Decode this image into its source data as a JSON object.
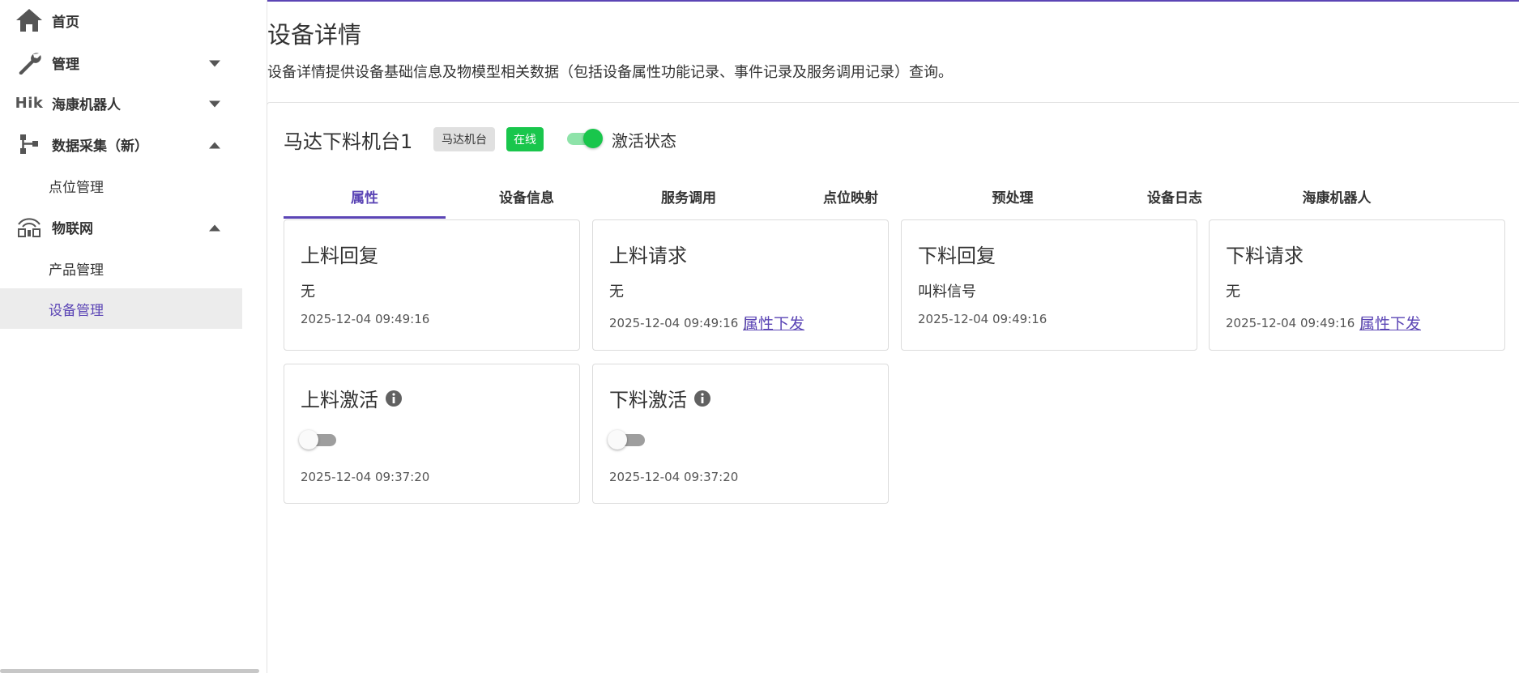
{
  "sidebar": {
    "items": [
      {
        "label": "首页",
        "icon": "home-icon"
      },
      {
        "label": "管理",
        "icon": "wrench-icon",
        "caret": "down"
      },
      {
        "label": "海康机器人",
        "icon": "hik-logo",
        "logo_text": "Hik",
        "caret": "down"
      },
      {
        "label": "数据采集（新）",
        "icon": "hierarchy-icon",
        "caret": "up"
      },
      {
        "label": "点位管理"
      },
      {
        "label": "物联网",
        "icon": "iot-icon",
        "caret": "up"
      },
      {
        "label": "产品管理"
      },
      {
        "label": "设备管理",
        "active": true
      }
    ]
  },
  "page": {
    "title": "设备详情",
    "description": "设备详情提供设备基础信息及物模型相关数据（包括设备属性功能记录、事件记录及服务调用记录）查询。"
  },
  "device": {
    "name": "马达下料机台1",
    "model_chip": "马达机台",
    "status_chip": "在线",
    "status_color": "#19c64c",
    "active_toggle_on": true,
    "active_label": "激活状态"
  },
  "tabs": [
    {
      "label": "属性",
      "active": true
    },
    {
      "label": "设备信息"
    },
    {
      "label": "服务调用"
    },
    {
      "label": "点位映射"
    },
    {
      "label": "预处理"
    },
    {
      "label": "设备日志"
    },
    {
      "label": "海康机器人"
    }
  ],
  "cards": [
    {
      "title": "上料回复",
      "value": "无",
      "time": "2025-12-04 09:49:16"
    },
    {
      "title": "上料请求",
      "value": "无",
      "time": "2025-12-04 09:49:16",
      "separator": "|",
      "link": "属性下发"
    },
    {
      "title": "下料回复",
      "value": "叫料信号",
      "time": "2025-12-04 09:49:16"
    },
    {
      "title": "下料请求",
      "value": "无",
      "time": "2025-12-04 09:49:16",
      "separator": "|",
      "link": "属性下发"
    },
    {
      "title": "上料激活",
      "toggle_on": false,
      "time": "2025-12-04 09:37:20"
    },
    {
      "title": "下料激活",
      "toggle_on": false,
      "time": "2025-12-04 09:37:20"
    }
  ],
  "colors": {
    "accent": "#5b45b5",
    "online": "#19c64c"
  }
}
